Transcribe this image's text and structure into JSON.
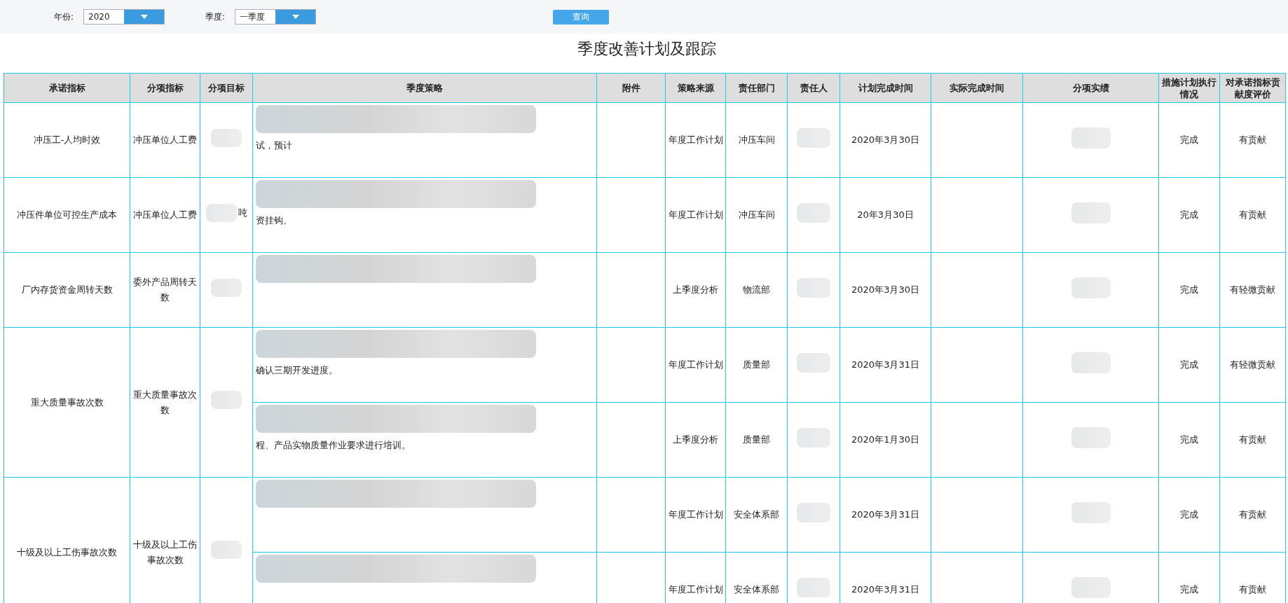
{
  "filters": {
    "year_label": "年份:",
    "year_value": "2020",
    "quarter_label": "季度:",
    "quarter_value": "一季度",
    "query_button": "查询"
  },
  "title": "季度改善计划及跟踪",
  "table": {
    "columns": [
      "承诺指标",
      "分项指标",
      "分项目标",
      "季度策略",
      "附件",
      "策略来源",
      "责任部门",
      "责任人",
      "计划完成时间",
      "实际完成时间",
      "分项实绩",
      "措施计划执行情况",
      "对承诺指标贡献度评价"
    ],
    "groups": [
      {
        "indicator": "冲压工-人均时效",
        "sub_indicator": "冲压单位人工费",
        "items": [
          {
            "strategy_fragment": "试，预计",
            "source": "年度工作计划",
            "department": "冲压车间",
            "plan_date": "2020年3月30日",
            "execution": "完成",
            "evaluation": "有贡献"
          }
        ]
      },
      {
        "indicator": "冲压件单位可控生产成本",
        "sub_indicator": "冲压单位人工费",
        "target_fragment": "吨",
        "items": [
          {
            "strategy_fragment": "资挂钩。",
            "source": "年度工作计划",
            "department": "冲压车间",
            "plan_date": "20年3月30日",
            "execution": "完成",
            "evaluation": "有贡献"
          }
        ]
      },
      {
        "indicator": "厂内存货资金周转天数",
        "sub_indicator": "委外产品周转天数",
        "items": [
          {
            "source": "上季度分析",
            "department": "物流部",
            "plan_date": "2020年3月30日",
            "execution": "完成",
            "evaluation": "有轻微贡献"
          }
        ]
      },
      {
        "indicator": "重大质量事故次数",
        "sub_indicator": "重大质量事故次数",
        "items": [
          {
            "strategy_fragment": "确认三期开发进度。",
            "source": "年度工作计划",
            "department": "质量部",
            "plan_date": "2020年3月31日",
            "execution": "完成",
            "evaluation": "有轻微贡献"
          },
          {
            "strategy_fragment": "程、产品实物质量作业要求进行培训。",
            "source": "上季度分析",
            "department": "质量部",
            "plan_date": "2020年1月30日",
            "execution": "完成",
            "evaluation": "有贡献"
          }
        ]
      },
      {
        "indicator": "十级及以上工伤事故次数",
        "sub_indicator": "十级及以上工伤事故次数",
        "items": [
          {
            "source": "年度工作计划",
            "department": "安全体系部",
            "plan_date": "2020年3月31日",
            "execution": "完成",
            "evaluation": "有贡献"
          },
          {
            "source": "年度工作计划",
            "department": "安全体系部",
            "plan_date": "2020年3月31日",
            "execution": "完成",
            "evaluation": "有贡献"
          }
        ]
      }
    ]
  }
}
